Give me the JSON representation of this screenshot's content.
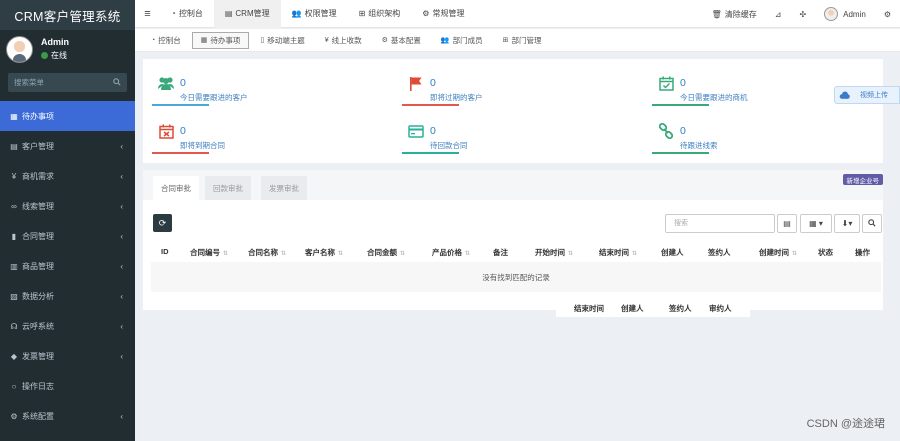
{
  "app": {
    "title": "CRM客户管理系统"
  },
  "user": {
    "name": "Admin",
    "status": "在线"
  },
  "sidebar": {
    "search_placeholder": "搜索菜单",
    "items": [
      {
        "label": "待办事项",
        "icon": "calendar-icon",
        "active": true,
        "has_children": false
      },
      {
        "label": "客户管理",
        "icon": "id-card-icon",
        "has_children": true
      },
      {
        "label": "商机需求",
        "icon": "yen-icon",
        "has_children": true
      },
      {
        "label": "线索管理",
        "icon": "link-icon",
        "has_children": true
      },
      {
        "label": "合同管理",
        "icon": "bookmark-icon",
        "has_children": true
      },
      {
        "label": "商品管理",
        "icon": "table-icon",
        "has_children": true
      },
      {
        "label": "数据分析",
        "icon": "bar-chart-icon",
        "has_children": true
      },
      {
        "label": "云呼系统",
        "icon": "headset-icon",
        "has_children": true
      },
      {
        "label": "发票管理",
        "icon": "tag-icon",
        "has_children": true
      },
      {
        "label": "操作日志",
        "icon": "circle-icon",
        "has_children": false
      },
      {
        "label": "系统配置",
        "icon": "gears-icon",
        "has_children": true
      }
    ]
  },
  "topbar": {
    "tabs": [
      {
        "label": "控制台",
        "icon": "dashboard-icon"
      },
      {
        "label": "CRM管理",
        "icon": "id-card-icon",
        "active": true
      },
      {
        "label": "权限管理",
        "icon": "users-icon"
      },
      {
        "label": "组织架构",
        "icon": "sitemap-icon"
      },
      {
        "label": "常规管理",
        "icon": "cogs-icon"
      }
    ],
    "right": {
      "clear_cache": "清除缓存",
      "admin": "Admin"
    }
  },
  "subtabs": [
    {
      "label": "控制台",
      "icon": "dashboard-icon"
    },
    {
      "label": "待办事项",
      "icon": "calendar-icon",
      "active": true
    },
    {
      "label": "移动端主题",
      "icon": "mobile-icon"
    },
    {
      "label": "线上收款",
      "icon": "yen-icon"
    },
    {
      "label": "基本配置",
      "icon": "gear-icon"
    },
    {
      "label": "部门成员",
      "icon": "users-icon"
    },
    {
      "label": "部门管理",
      "icon": "sitemap-icon"
    }
  ],
  "stats": [
    {
      "value": "0",
      "label": "今日需要跟进的客户",
      "icon": "users-icon",
      "color": "#3aa87a"
    },
    {
      "value": "0",
      "label": "即将过期的客户",
      "icon": "flag-icon",
      "color": "#dd4b39"
    },
    {
      "value": "0",
      "label": "今日需要跟进的商机",
      "icon": "calendar-check-icon",
      "color": "#3aa87a"
    },
    {
      "value": "0",
      "label": "即将到期合同",
      "icon": "calendar-x-icon",
      "color": "#dd4b39"
    },
    {
      "value": "0",
      "label": "待回款合同",
      "icon": "credit-card-icon",
      "color": "#28b09a"
    },
    {
      "value": "0",
      "label": "待跟进线索",
      "icon": "link-icon",
      "color": "#3aa87a"
    }
  ],
  "float_button": {
    "label": "视频上传"
  },
  "content": {
    "tabs": [
      {
        "label": "合同审批",
        "active": true
      },
      {
        "label": "回款审批"
      },
      {
        "label": "发票审批"
      }
    ],
    "badge": "新增企业号",
    "search_placeholder": "搜索",
    "columns": [
      "ID",
      "合同编号",
      "合同名称",
      "客户名称",
      "合同金额",
      "产品价格",
      "备注",
      "开始时间",
      "结束时间",
      "创建人",
      "签约人",
      "创建时间",
      "状态",
      "操作"
    ],
    "empty_text": "没有找到匹配的记录",
    "sticky_columns": [
      "结束时间",
      "创建人",
      "签约人",
      "审约人"
    ]
  },
  "watermark": "CSDN @途途珺"
}
